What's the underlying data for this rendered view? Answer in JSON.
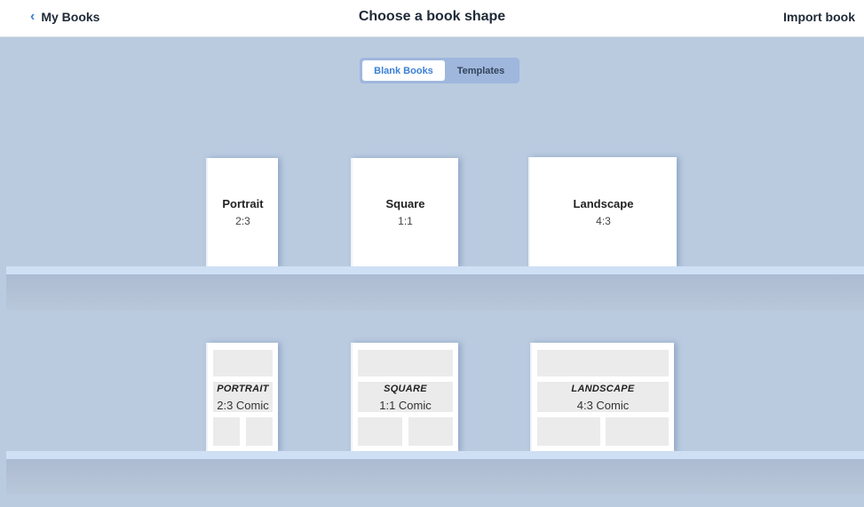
{
  "header": {
    "back_label": "My Books",
    "title": "Choose a book shape",
    "import_label": "Import book"
  },
  "tabs": [
    {
      "label": "Blank Books",
      "active": true
    },
    {
      "label": "Templates",
      "active": false
    }
  ],
  "blank_books": [
    {
      "name": "Portrait",
      "ratio": "2:3"
    },
    {
      "name": "Square",
      "ratio": "1:1"
    },
    {
      "name": "Landscape",
      "ratio": "4:3"
    }
  ],
  "comic_books": [
    {
      "name": "PORTRAIT",
      "ratio": "2:3 Comic"
    },
    {
      "name": "SQUARE",
      "ratio": "1:1 Comic"
    },
    {
      "name": "LANDSCAPE",
      "ratio": "4:3 Comic"
    }
  ],
  "colors": {
    "accent": "#3a7fd5",
    "background": "#bacbe0",
    "segment_bg": "#9fb7dd",
    "shelf": "#cfe0f5"
  },
  "icons": {
    "back": "chevron-left-icon"
  }
}
